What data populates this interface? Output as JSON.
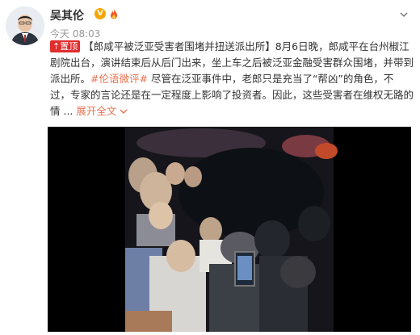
{
  "user": {
    "name": "吴其伦",
    "verified_badge": "V",
    "verified_color": "#f7a400"
  },
  "post": {
    "timestamp": "今天 08:03",
    "pin_label": "置顶",
    "headline": "【郎咸平被泛亚受害者围堵并扭送派出所】",
    "body_1": "8月6日晚，郎咸平在台州椒江剧院出台，演讲结束后从后门出来，坐上车之后被泛亚金融受害群众围堵，并带到派出所。",
    "hashtag": "#伦语微评#",
    "body_2": " 尽管在泛亚事件中，老郎只是充当了“帮凶”的角色，不过，专家的言论还是在一定程度上影响了投资者。因此，这些受害者在维权无路的情 ...",
    "expand_label": "展开全文",
    "expand_icon": "chevron-down-icon"
  },
  "colors": {
    "link": "#eb7350",
    "pin": "#e02d2d"
  },
  "icons": {
    "menu": "chevron-down-icon",
    "special_badge": "fire-icon"
  }
}
